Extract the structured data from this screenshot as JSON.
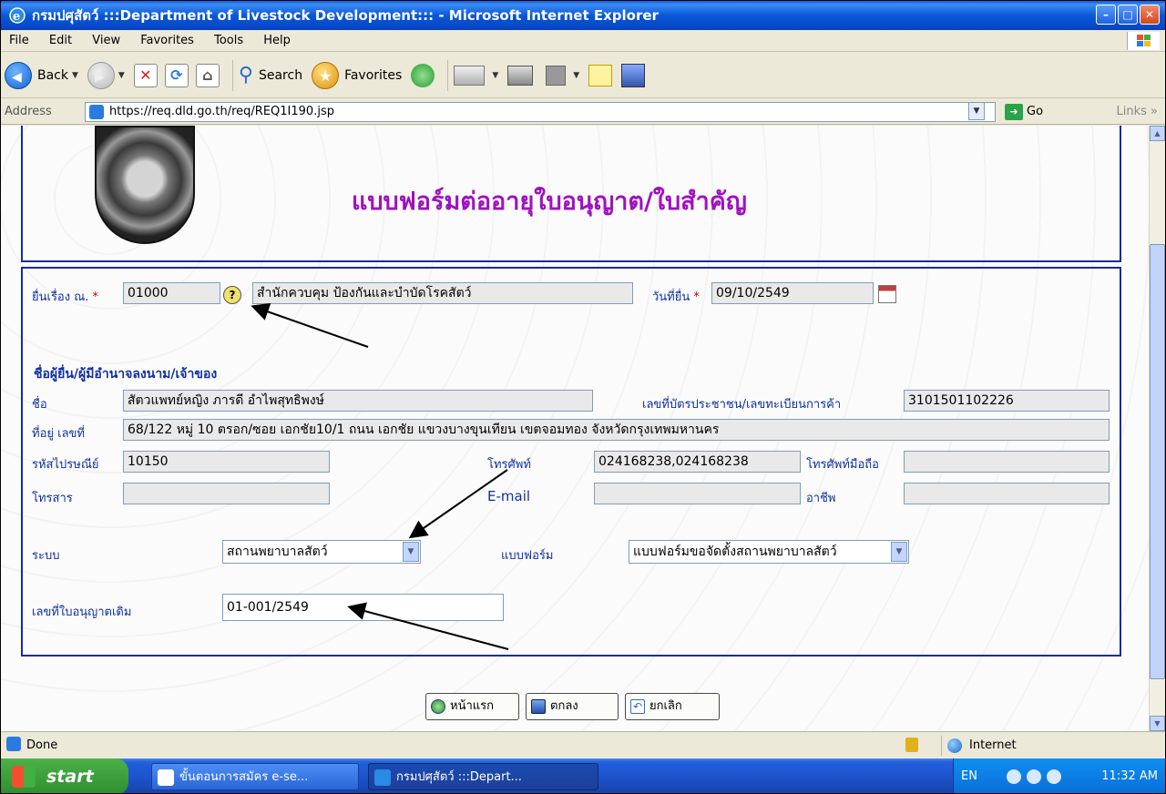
{
  "window": {
    "title": "กรมปศุสัตว์ :::Department of Livestock Development::: - Microsoft Internet Explorer",
    "controls": [
      "–",
      "□",
      "✕"
    ]
  },
  "menu": [
    "File",
    "Edit",
    "View",
    "Favorites",
    "Tools",
    "Help"
  ],
  "toolbar": {
    "back_label": "Back",
    "search_label": "Search",
    "favorites_label": "Favorites"
  },
  "address": {
    "label": "Address",
    "url": "https://req.dld.go.th/req/REQ1I190.jsp",
    "go_label": "Go",
    "links_label": "Links"
  },
  "page": {
    "heading": "แบบฟอร์มต่ออายุใบอนุญาต/ใบสำคัญ",
    "submit_at": {
      "label": "ยื่นเรื่อง ณ.",
      "code": "01000",
      "office": "สำนักควบคุม ป้องกันและบำบัดโรคสัตว์"
    },
    "submit_date": {
      "label": "วันที่ยื่น",
      "value": "09/10/2549"
    },
    "applicant_section": "ชื่อผู้ยื่น/ผู้มีอำนาจลงนาม/เจ้าของ",
    "name": {
      "label": "ชื่อ",
      "value": "สัตวแพทย์หญิง ภารดี อำไพสุทธิพงษ์"
    },
    "id_number": {
      "label": "เลขที่บัตรประชาชน/เลขทะเบียนการค้า",
      "value": "3101501102226"
    },
    "address_no": {
      "label": "ที่อยู่ เลขที่",
      "value": "68/122 หมู่ 10 ตรอก/ซอย เอกชัย10/1 ถนน เอกชัย แขวงบางขุนเทียน เขตจอมทอง จังหวัดกรุงเทพมหานคร"
    },
    "postcode": {
      "label": "รหัสไปรษณีย์",
      "value": "10150"
    },
    "phone": {
      "label": "โทรศัพท์",
      "value": "024168238,024168238"
    },
    "mobile": {
      "label": "โทรศัพท์มือถือ",
      "value": ""
    },
    "fax": {
      "label": "โทรสาร",
      "value": ""
    },
    "email": {
      "label": "E-mail",
      "value": ""
    },
    "occupation": {
      "label": "อาชีพ",
      "value": ""
    },
    "system": {
      "label": "ระบบ",
      "value": "สถานพยาบาลสัตว์"
    },
    "form_type": {
      "label": "แบบฟอร์ม",
      "value": "แบบฟอร์มขอจัดตั้งสถานพยาบาลสัตว์"
    },
    "old_license": {
      "label": "เลขที่ใบอนุญาตเดิม",
      "value": "01-001/2549"
    },
    "buttons": {
      "home": "หน้าแรก",
      "ok": "ตกลง",
      "cancel": "ยกเลิก"
    }
  },
  "status": {
    "text": "Done",
    "zone": "Internet"
  },
  "taskbar": {
    "start": "start",
    "task1": "ขั้นตอนการสมัคร e-se...",
    "task2": "กรมปศุสัตว์ :::Depart...",
    "lang": "EN",
    "time": "11:32 AM"
  },
  "colors": {
    "heading": "#a010c0",
    "label": "#1030a0",
    "frame": "#1a2aa0",
    "required": "#d00000"
  }
}
